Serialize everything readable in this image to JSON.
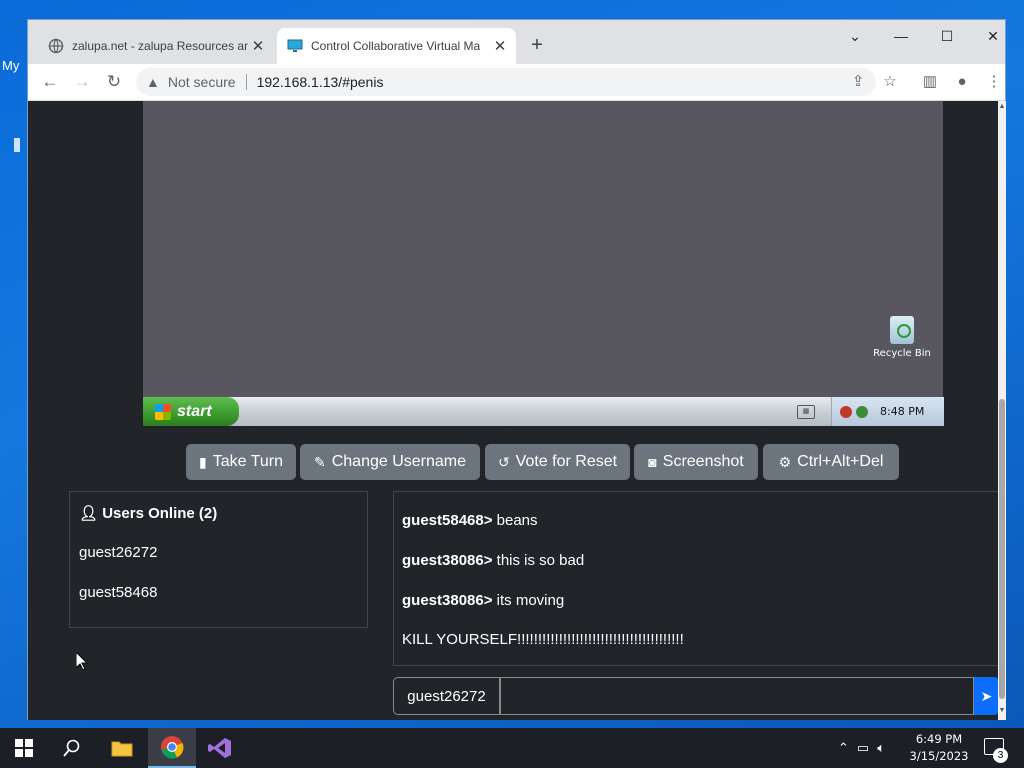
{
  "desktop": {
    "partial_label": "My"
  },
  "browser": {
    "tabs": [
      {
        "title": "zalupa.net - zalupa Resources an",
        "close": "✕"
      },
      {
        "title": "Control Collaborative Virtual Ma",
        "close": "✕"
      }
    ],
    "new_tab": "+",
    "window_buttons": {
      "dropdown": "⌄",
      "minimize": "—",
      "maximize": "☐",
      "close": "✕"
    },
    "address_bar": {
      "security_label": "Not secure",
      "url": "192.168.1.13/#penis"
    }
  },
  "vm": {
    "desktop_icon_label": "Recycle Bin",
    "start_label": "start",
    "clock": "8:48 PM"
  },
  "controls": {
    "take_turn": "Take Turn",
    "change_username": "Change Username",
    "vote_reset": "Vote for Reset",
    "screenshot": "Screenshot",
    "ctrl_alt_del": "Ctrl+Alt+Del"
  },
  "users": {
    "heading": "Users Online (2)",
    "list": [
      "guest26272",
      "guest58468"
    ]
  },
  "chat": {
    "messages": [
      {
        "user": "guest58468>",
        "text": " beans"
      },
      {
        "user": "guest38086>",
        "text": " this is so bad"
      },
      {
        "user": "guest38086>",
        "text": " its moving"
      },
      {
        "user": "",
        "text": "KILL YOURSELF!!!!!!!!!!!!!!!!!!!!!!!!!!!!!!!!!!!!!!!!"
      }
    ],
    "username": "guest26272",
    "input_value": ""
  },
  "taskbar": {
    "time": "6:49 PM",
    "date": "3/15/2023",
    "notification_count": "3"
  }
}
